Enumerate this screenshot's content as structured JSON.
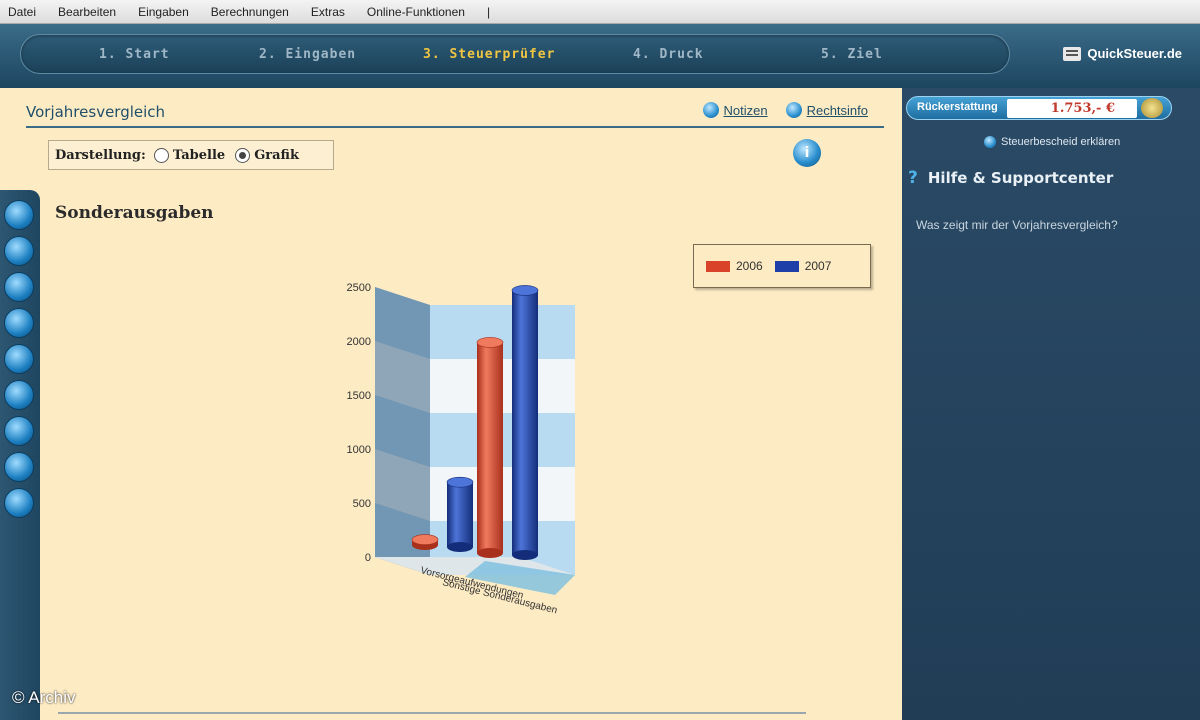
{
  "menu": [
    "Datei",
    "Bearbeiten",
    "Eingaben",
    "Berechnungen",
    "Extras",
    "Online-Funktionen",
    "|"
  ],
  "wizard": {
    "steps": [
      "1. Start",
      "2. Eingaben",
      "3. Steuerprüfer",
      "4. Druck",
      "5. Ziel"
    ],
    "active_index": 2,
    "brand": "QuickSteuer.de"
  },
  "page": {
    "title": "Vorjahresvergleich",
    "links": [
      "Notizen",
      "Rechtsinfo"
    ],
    "display_label": "Darstellung:",
    "options": [
      "Tabelle",
      "Grafik"
    ],
    "selected_option": "Grafik",
    "copyright": "© Archiv"
  },
  "sidebar_right": {
    "refund_label": "Rückerstattung",
    "refund_value": "1.753,- €",
    "explain_link": "Steuerbescheid erklären",
    "help_title": "Hilfe & Supportcenter",
    "help_question": "Was zeigt mir der Vorjahresvergleich?"
  },
  "chart_data": {
    "type": "bar",
    "title": "Sonderausgaben",
    "categories": [
      "Vorsorgeaufwendungen",
      "Sonstige Sonderausgaben"
    ],
    "series": [
      {
        "name": "2006",
        "color": "#d8432a",
        "values": [
          50,
          1950
        ]
      },
      {
        "name": "2007",
        "color": "#1e3fa8",
        "values": [
          600,
          2450
        ]
      }
    ],
    "ylim": [
      0,
      2500
    ],
    "yticks": [
      0,
      500,
      1000,
      1500,
      2000,
      2500
    ],
    "legend_position": "top-right",
    "grid": true
  },
  "colors": {
    "content_bg": "#fdebc4",
    "sidebar_bg": "#243f58",
    "accent": "#f1c642"
  }
}
